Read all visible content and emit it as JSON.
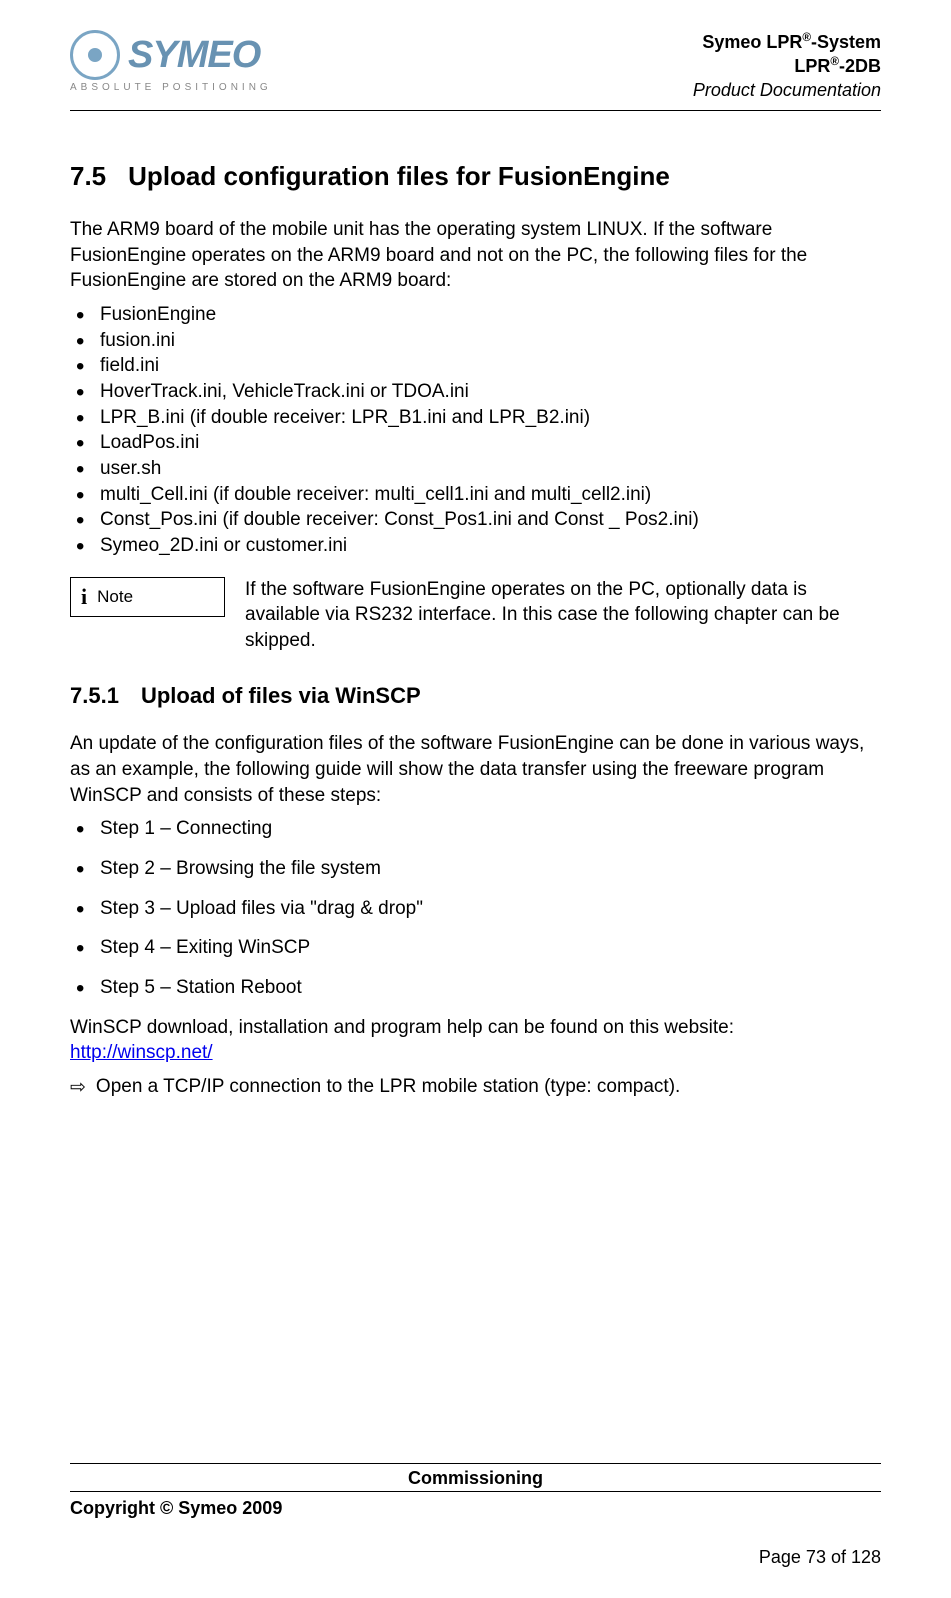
{
  "header": {
    "logo_name": "SYMEO",
    "logo_tagline": "ABSOLUTE POSITIONING",
    "line1_a": "Symeo LPR",
    "line1_sup": "®",
    "line1_b": "-System",
    "line2_a": "LPR",
    "line2_sup": "®",
    "line2_b": "-2DB",
    "line3": "Product Documentation"
  },
  "section": {
    "num": "7.5",
    "title": "Upload configuration files for FusionEngine",
    "intro": "The ARM9 board of the mobile unit has the operating system LINUX. If the software FusionEngine operates on the ARM9 board and not on the PC, the following files for the FusionEngine are stored on the ARM9 board:",
    "files": [
      "FusionEngine",
      "fusion.ini",
      "field.ini",
      "HoverTrack.ini, VehicleTrack.ini or TDOA.ini",
      "LPR_B.ini (if double receiver: LPR_B1.ini and LPR_B2.ini)",
      "LoadPos.ini",
      "user.sh",
      "multi_Cell.ini (if double receiver: multi_cell1.ini and multi_cell2.ini)",
      "Const_Pos.ini (if double receiver: Const_Pos1.ini and Const _ Pos2.ini)",
      "Symeo_2D.ini or customer.ini"
    ]
  },
  "note": {
    "icon": "i",
    "label": "Note",
    "text": "If the software FusionEngine operates on the PC, optionally data is available via RS232 interface. In this case the following chapter can be skipped."
  },
  "subsection": {
    "num": "7.5.1",
    "title": "Upload of files via WinSCP",
    "intro": "An update of the configuration files of the software FusionEngine can be done in various ways, as an example, the following guide will show the data transfer using the freeware program WinSCP and consists of these steps:",
    "steps": [
      "Step 1 – Connecting",
      "Step 2 – Browsing the file system",
      "Step 3 – Upload files via \"drag & drop\"",
      "Step 4 – Exiting WinSCP",
      "Step 5 – Station Reboot"
    ],
    "download_text": "WinSCP download, installation and program help can be found on this website:",
    "download_link": "http://winscp.net/",
    "arrow": "⇨",
    "instruction": "Open a TCP/IP connection to the LPR mobile station (type: compact)."
  },
  "footer": {
    "section": "Commissioning",
    "copyright": "Copyright © Symeo 2009",
    "page": "Page 73 of 128"
  }
}
